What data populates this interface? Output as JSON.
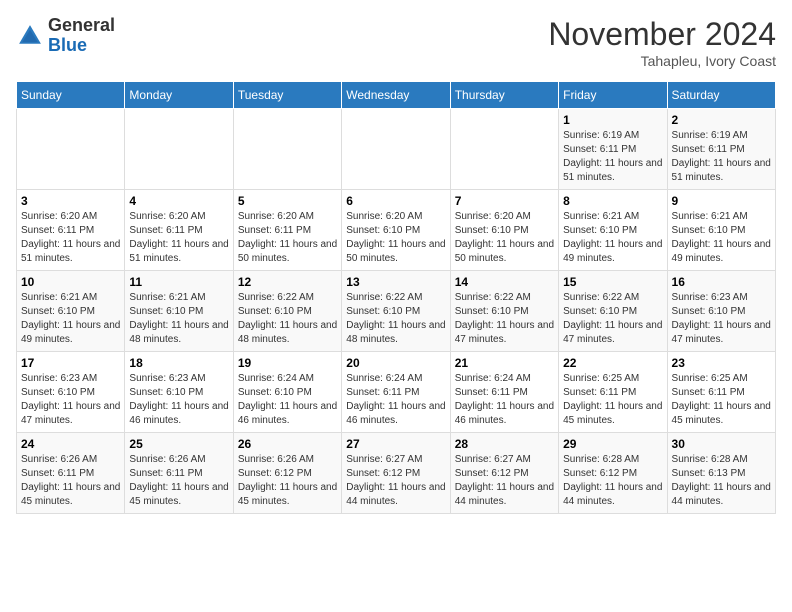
{
  "header": {
    "logo_general": "General",
    "logo_blue": "Blue",
    "month_title": "November 2024",
    "location": "Tahapleu, Ivory Coast"
  },
  "days_of_week": [
    "Sunday",
    "Monday",
    "Tuesday",
    "Wednesday",
    "Thursday",
    "Friday",
    "Saturday"
  ],
  "weeks": [
    [
      {
        "day": "",
        "info": ""
      },
      {
        "day": "",
        "info": ""
      },
      {
        "day": "",
        "info": ""
      },
      {
        "day": "",
        "info": ""
      },
      {
        "day": "",
        "info": ""
      },
      {
        "day": "1",
        "info": "Sunrise: 6:19 AM\nSunset: 6:11 PM\nDaylight: 11 hours and 51 minutes."
      },
      {
        "day": "2",
        "info": "Sunrise: 6:19 AM\nSunset: 6:11 PM\nDaylight: 11 hours and 51 minutes."
      }
    ],
    [
      {
        "day": "3",
        "info": "Sunrise: 6:20 AM\nSunset: 6:11 PM\nDaylight: 11 hours and 51 minutes."
      },
      {
        "day": "4",
        "info": "Sunrise: 6:20 AM\nSunset: 6:11 PM\nDaylight: 11 hours and 51 minutes."
      },
      {
        "day": "5",
        "info": "Sunrise: 6:20 AM\nSunset: 6:11 PM\nDaylight: 11 hours and 50 minutes."
      },
      {
        "day": "6",
        "info": "Sunrise: 6:20 AM\nSunset: 6:10 PM\nDaylight: 11 hours and 50 minutes."
      },
      {
        "day": "7",
        "info": "Sunrise: 6:20 AM\nSunset: 6:10 PM\nDaylight: 11 hours and 50 minutes."
      },
      {
        "day": "8",
        "info": "Sunrise: 6:21 AM\nSunset: 6:10 PM\nDaylight: 11 hours and 49 minutes."
      },
      {
        "day": "9",
        "info": "Sunrise: 6:21 AM\nSunset: 6:10 PM\nDaylight: 11 hours and 49 minutes."
      }
    ],
    [
      {
        "day": "10",
        "info": "Sunrise: 6:21 AM\nSunset: 6:10 PM\nDaylight: 11 hours and 49 minutes."
      },
      {
        "day": "11",
        "info": "Sunrise: 6:21 AM\nSunset: 6:10 PM\nDaylight: 11 hours and 48 minutes."
      },
      {
        "day": "12",
        "info": "Sunrise: 6:22 AM\nSunset: 6:10 PM\nDaylight: 11 hours and 48 minutes."
      },
      {
        "day": "13",
        "info": "Sunrise: 6:22 AM\nSunset: 6:10 PM\nDaylight: 11 hours and 48 minutes."
      },
      {
        "day": "14",
        "info": "Sunrise: 6:22 AM\nSunset: 6:10 PM\nDaylight: 11 hours and 47 minutes."
      },
      {
        "day": "15",
        "info": "Sunrise: 6:22 AM\nSunset: 6:10 PM\nDaylight: 11 hours and 47 minutes."
      },
      {
        "day": "16",
        "info": "Sunrise: 6:23 AM\nSunset: 6:10 PM\nDaylight: 11 hours and 47 minutes."
      }
    ],
    [
      {
        "day": "17",
        "info": "Sunrise: 6:23 AM\nSunset: 6:10 PM\nDaylight: 11 hours and 47 minutes."
      },
      {
        "day": "18",
        "info": "Sunrise: 6:23 AM\nSunset: 6:10 PM\nDaylight: 11 hours and 46 minutes."
      },
      {
        "day": "19",
        "info": "Sunrise: 6:24 AM\nSunset: 6:10 PM\nDaylight: 11 hours and 46 minutes."
      },
      {
        "day": "20",
        "info": "Sunrise: 6:24 AM\nSunset: 6:11 PM\nDaylight: 11 hours and 46 minutes."
      },
      {
        "day": "21",
        "info": "Sunrise: 6:24 AM\nSunset: 6:11 PM\nDaylight: 11 hours and 46 minutes."
      },
      {
        "day": "22",
        "info": "Sunrise: 6:25 AM\nSunset: 6:11 PM\nDaylight: 11 hours and 45 minutes."
      },
      {
        "day": "23",
        "info": "Sunrise: 6:25 AM\nSunset: 6:11 PM\nDaylight: 11 hours and 45 minutes."
      }
    ],
    [
      {
        "day": "24",
        "info": "Sunrise: 6:26 AM\nSunset: 6:11 PM\nDaylight: 11 hours and 45 minutes."
      },
      {
        "day": "25",
        "info": "Sunrise: 6:26 AM\nSunset: 6:11 PM\nDaylight: 11 hours and 45 minutes."
      },
      {
        "day": "26",
        "info": "Sunrise: 6:26 AM\nSunset: 6:12 PM\nDaylight: 11 hours and 45 minutes."
      },
      {
        "day": "27",
        "info": "Sunrise: 6:27 AM\nSunset: 6:12 PM\nDaylight: 11 hours and 44 minutes."
      },
      {
        "day": "28",
        "info": "Sunrise: 6:27 AM\nSunset: 6:12 PM\nDaylight: 11 hours and 44 minutes."
      },
      {
        "day": "29",
        "info": "Sunrise: 6:28 AM\nSunset: 6:12 PM\nDaylight: 11 hours and 44 minutes."
      },
      {
        "day": "30",
        "info": "Sunrise: 6:28 AM\nSunset: 6:13 PM\nDaylight: 11 hours and 44 minutes."
      }
    ]
  ]
}
